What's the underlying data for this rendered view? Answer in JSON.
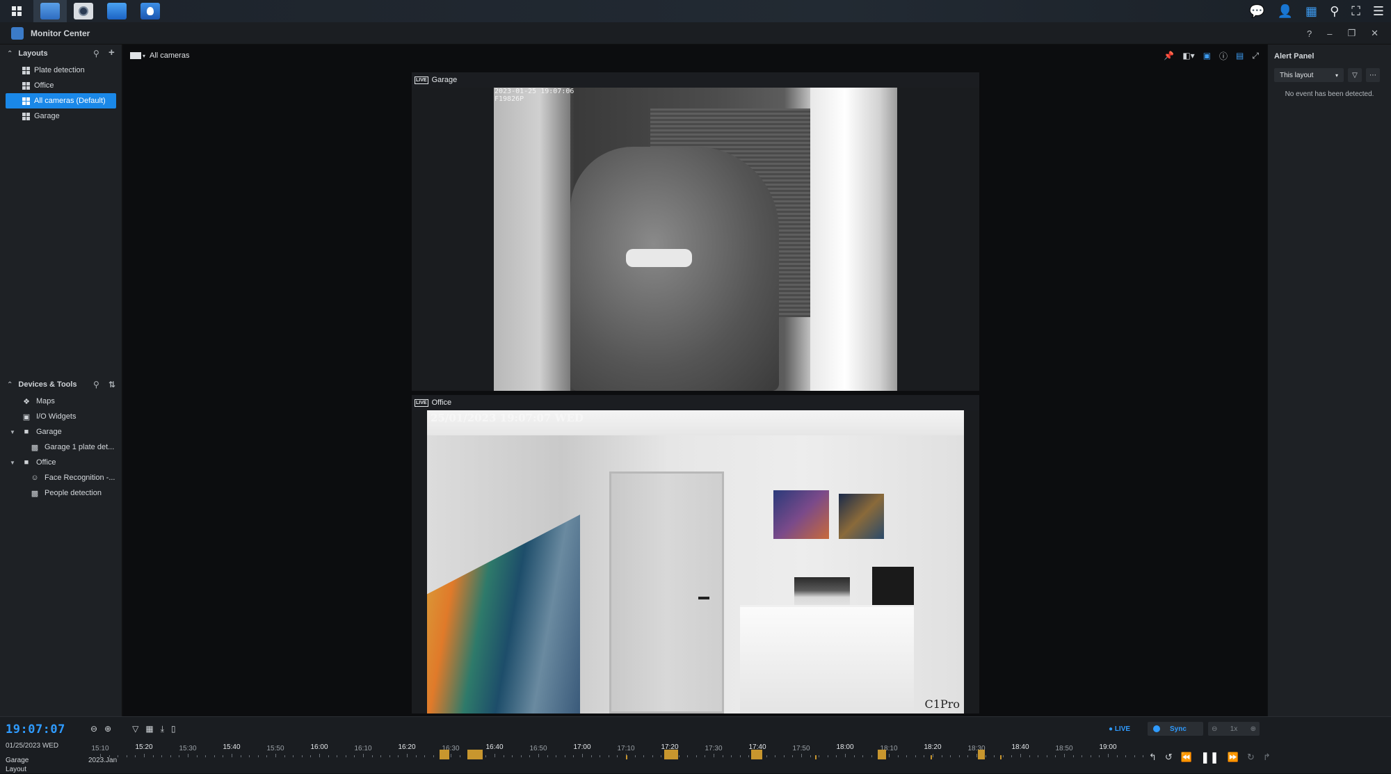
{
  "taskbar": {
    "apps": [
      "main-menu",
      "surveillance-station",
      "camera-app",
      "monitor-center",
      "face-app"
    ],
    "right_icons": [
      "notification-icon",
      "user-icon",
      "widgets-icon",
      "search-icon",
      "fullscreen-icon",
      "menu-icon"
    ]
  },
  "window": {
    "title": "Monitor Center",
    "controls": [
      "help-icon",
      "minimize-icon",
      "restore-icon",
      "close-icon"
    ]
  },
  "layouts": {
    "header": "Layouts",
    "items": [
      {
        "label": "Plate detection",
        "selected": false
      },
      {
        "label": "Office",
        "selected": false
      },
      {
        "label": "All cameras (Default)",
        "selected": true
      },
      {
        "label": "Garage",
        "selected": false
      }
    ]
  },
  "devices": {
    "header": "Devices & Tools",
    "items": [
      {
        "label": "Maps",
        "icon": "map-icon",
        "level": 1
      },
      {
        "label": "I/O Widgets",
        "icon": "io-widget-icon",
        "level": 1
      },
      {
        "label": "Garage",
        "icon": "camera-icon",
        "level": 1,
        "expandable": true
      },
      {
        "label": "Garage 1 plate det...",
        "icon": "plate-detection-icon",
        "level": 2
      },
      {
        "label": "Office",
        "icon": "camera-icon",
        "level": 1,
        "expandable": true
      },
      {
        "label": "Face Recognition -...",
        "icon": "face-recognition-icon",
        "level": 2
      },
      {
        "label": "People detection",
        "icon": "people-detection-icon",
        "level": 2
      }
    ]
  },
  "main": {
    "layout_name": "All cameras",
    "cameras": [
      {
        "name": "Garage",
        "badge": "LIVE",
        "osd_line1": "2023-01-25 19:07:06",
        "osd_line2": "F19826P"
      },
      {
        "name": "Office",
        "badge": "LIVE",
        "osd_line1": "25/01/2023 19:07:07 WED",
        "osd_brand": "C1Pro"
      }
    ]
  },
  "alert_panel": {
    "title": "Alert Panel",
    "filter_value": "This layout",
    "empty_message": "No event has been detected."
  },
  "timeline": {
    "time": "19:07:07",
    "date": "01/25/2023 WED",
    "row_camera": "Garage",
    "row_layout": "Layout",
    "month_label": "2023.Jan",
    "live_label": "LIVE",
    "sync_label": "Sync",
    "speed_label": "1x",
    "ticks": [
      {
        "label": "15:10",
        "major": false
      },
      {
        "label": "15:20",
        "major": true
      },
      {
        "label": "15:30",
        "major": false
      },
      {
        "label": "15:40",
        "major": true
      },
      {
        "label": "15:50",
        "major": false
      },
      {
        "label": "16:00",
        "major": true
      },
      {
        "label": "16:10",
        "major": false
      },
      {
        "label": "16:20",
        "major": true
      },
      {
        "label": "16:30",
        "major": false
      },
      {
        "label": "16:40",
        "major": true
      },
      {
        "label": "16:50",
        "major": false
      },
      {
        "label": "17:00",
        "major": true
      },
      {
        "label": "17:10",
        "major": false
      },
      {
        "label": "17:20",
        "major": true
      },
      {
        "label": "17:30",
        "major": false
      },
      {
        "label": "17:40",
        "major": true
      },
      {
        "label": "17:50",
        "major": false
      },
      {
        "label": "18:00",
        "major": true
      },
      {
        "label": "18:10",
        "major": false
      },
      {
        "label": "18:20",
        "major": true
      },
      {
        "label": "18:30",
        "major": false
      },
      {
        "label": "18:40",
        "major": true
      },
      {
        "label": "18:50",
        "major": false
      },
      {
        "label": "19:00",
        "major": true
      }
    ],
    "event_color": "#c8962e",
    "accent_color": "#2f9bff"
  }
}
